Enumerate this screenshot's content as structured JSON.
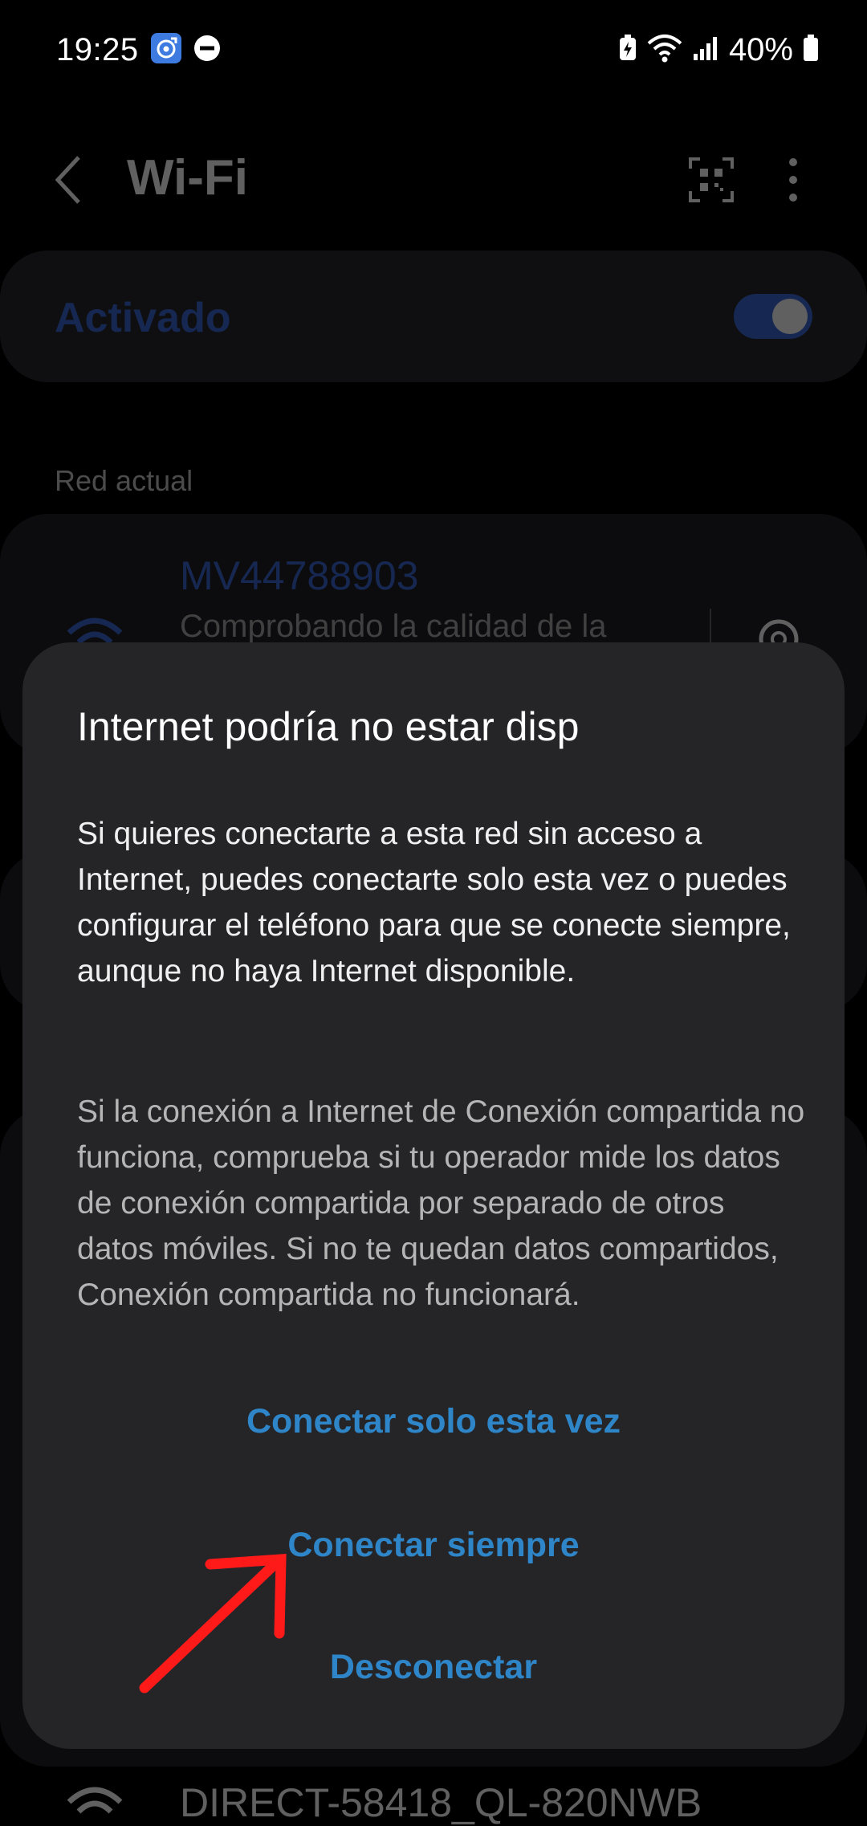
{
  "status_bar": {
    "time": "19:25",
    "battery": "40%"
  },
  "header": {
    "title": "Wi-Fi"
  },
  "wifi_toggle": {
    "label": "Activado",
    "state": "on",
    "accent": "#3b6bd8"
  },
  "current_network": {
    "section_label": "Red actual",
    "name": "MV44788903",
    "status": "Comprobando la calidad de la"
  },
  "other_networks": [
    {
      "name": "DIRECT-58418_QL-820NWB"
    }
  ],
  "dialog": {
    "title": "Internet podría no estar disp",
    "body1": "Si quieres conectarte a esta red sin acceso a Internet, puedes conectarte solo esta vez o puedes configurar el teléfono para que se conecte siempre, aunque no haya Internet disponible.",
    "body2": "Si la conexión a Internet de Conexión compartida no funciona, comprueba si tu operador mide los datos de conexión compartida por separado de otros datos móviles. Si no te quedan datos compartidos, Conexión compartida no funcionará.",
    "buttons": {
      "connect_once": "Conectar solo esta vez",
      "connect_always": "Conectar siempre",
      "disconnect": "Desconectar"
    },
    "button_color": "#2e86c9"
  },
  "annotation": {
    "arrow_color": "#ff1a1a"
  }
}
